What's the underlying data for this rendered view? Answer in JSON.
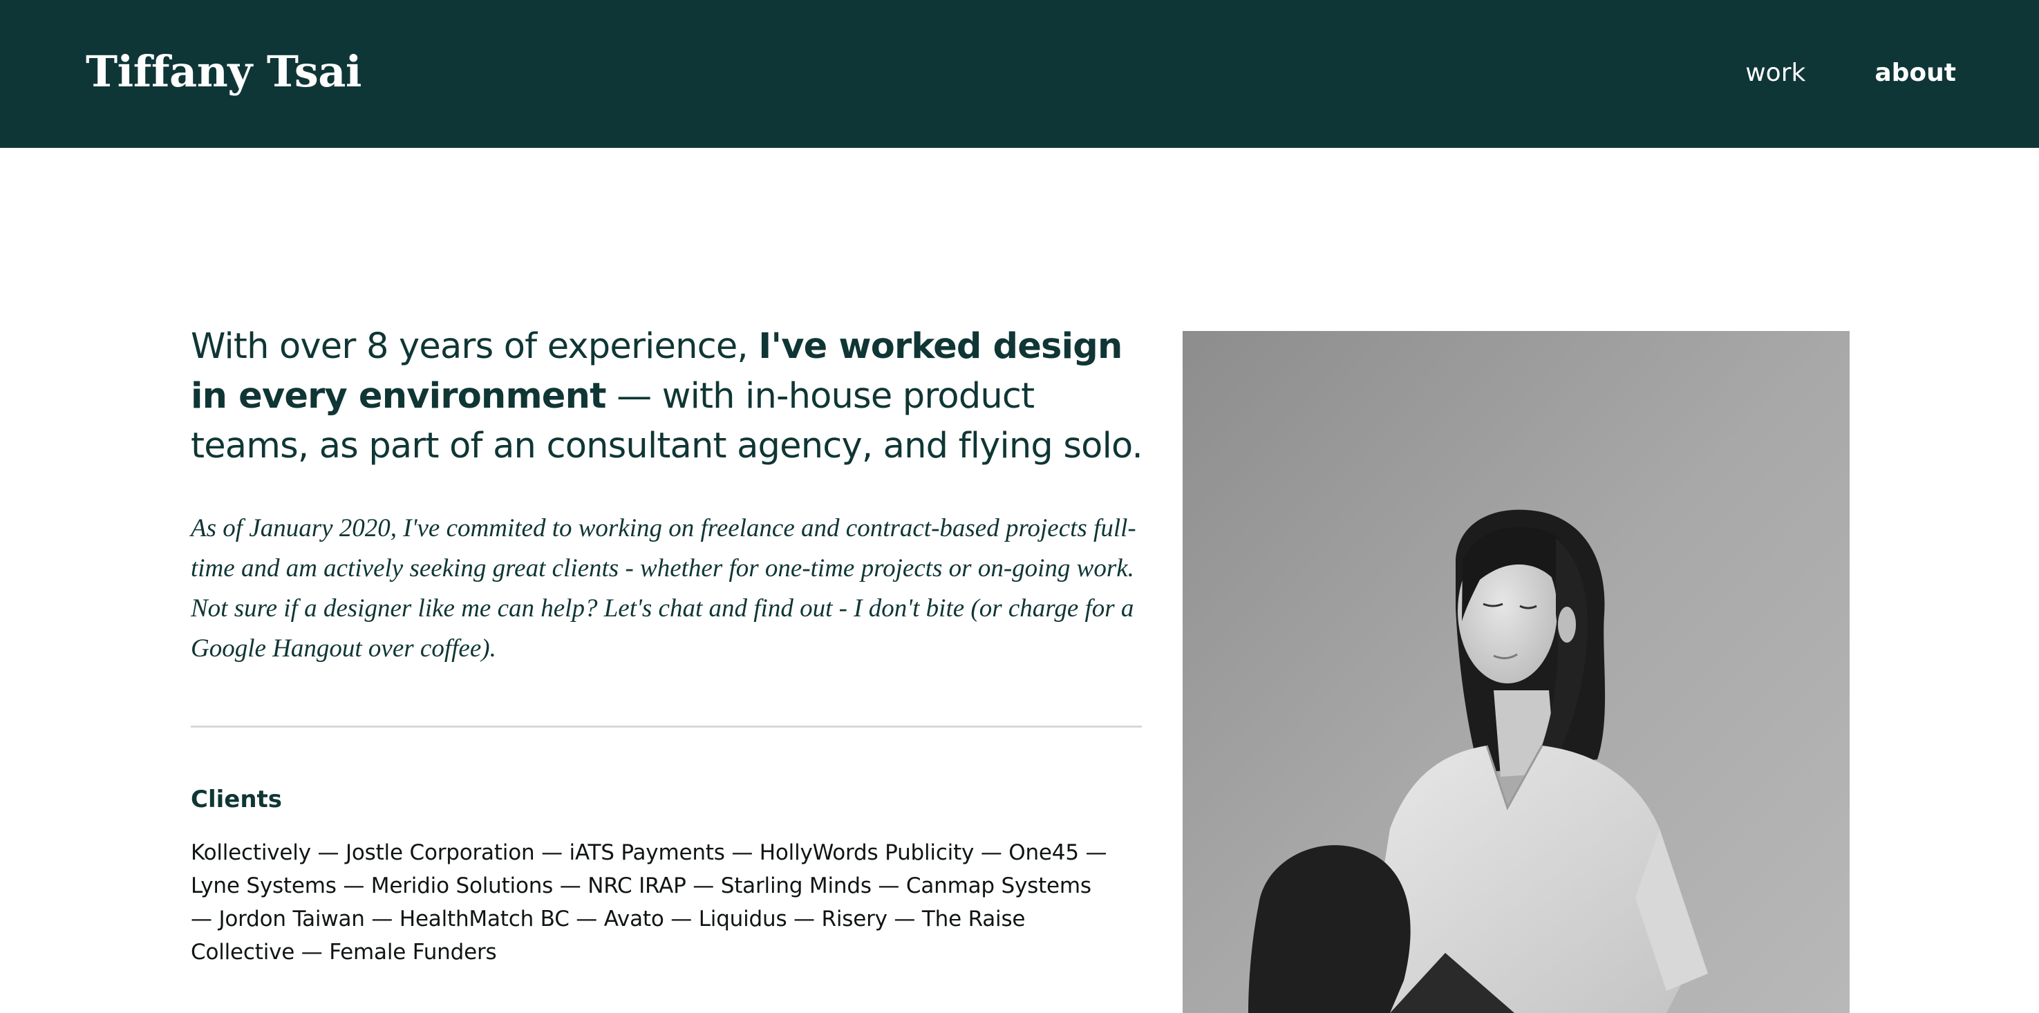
{
  "header": {
    "brand": "Tiffany Tsai",
    "nav": [
      {
        "label": "work",
        "active": false
      },
      {
        "label": "about",
        "active": true
      }
    ]
  },
  "intro": {
    "part1": "With over 8 years of experience, ",
    "bold": "I've worked design in every environment",
    "part2": " — with in-house product teams, as part of an consultant agency, and flying solo."
  },
  "note": "As of January 2020, I've commited to working on freelance and contract-based projects full-time and am actively seeking great clients - whether for one-time projects or on-going work. Not sure if a designer like me can help? Let's chat and find out - I don't bite (or charge for a Google Hangout over coffee).",
  "clients": {
    "title": "Clients",
    "list": "Kollectively — Jostle Corporation — iATS Payments — HollyWords Publicity — One45 — Lyne Systems — Meridio Solutions — NRC IRAP — Starling Minds — Canmap Systems — Jordon Taiwan — HealthMatch BC — Avato — Liquidus — Risery — The Raise Collective — Female Funders"
  },
  "colors": {
    "header_bg": "#0f3636",
    "text": "#0f3634",
    "divider": "#d8d8d8"
  }
}
